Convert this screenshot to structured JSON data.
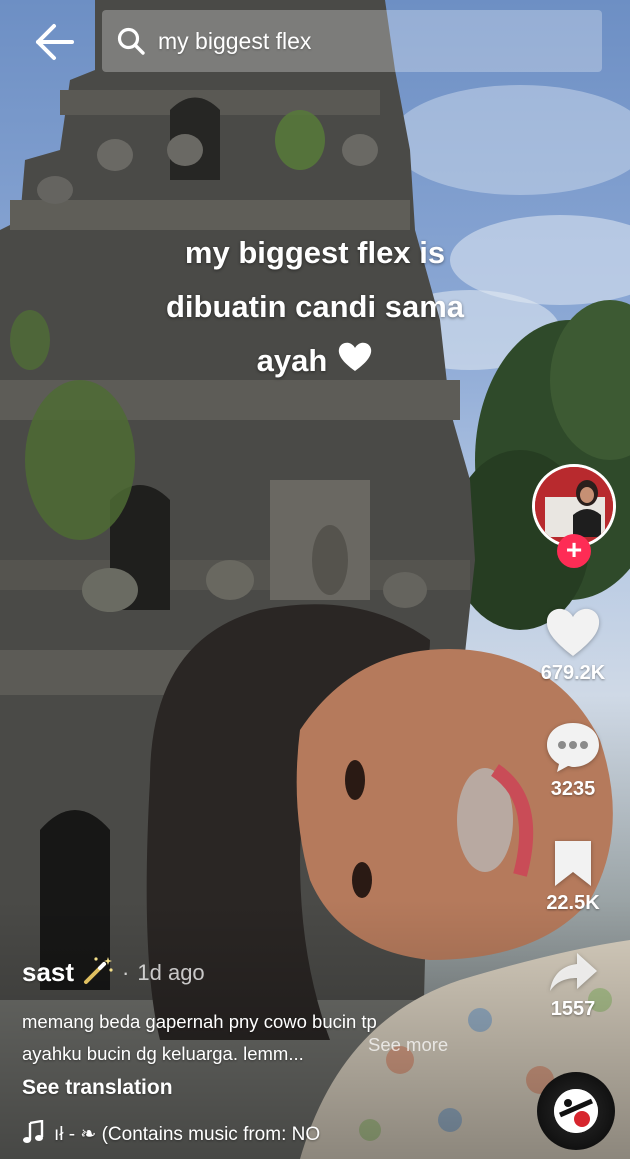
{
  "search": {
    "query": "my biggest flex"
  },
  "overlay_caption": {
    "line1": "my biggest flex is",
    "line2": "dibuatin candi sama",
    "line3": "ayah"
  },
  "actions": {
    "likes": "679.2K",
    "comments": "3235",
    "saves": "22.5K",
    "shares": "1557"
  },
  "author": {
    "name": "sast",
    "time": "1d ago"
  },
  "description": {
    "line1": "memang beda⁣ gapernah pny cowo bucin tp",
    "line2": "ayahku bucin dg keluarga. lemm...",
    "see_more": "See more"
  },
  "see_translation": "See translation",
  "music": {
    "track": "ıł - ❧ (Contains music from: NO"
  },
  "colors": {
    "follow": "#fe2c55",
    "text": "#ffffff"
  },
  "icons": {
    "back": "arrow-left-icon",
    "search": "search-icon",
    "heart": "heart-icon",
    "comment": "comment-icon",
    "bookmark": "bookmark-icon",
    "share": "share-icon",
    "music": "music-note-icon",
    "wand": "magic-wand-icon"
  }
}
